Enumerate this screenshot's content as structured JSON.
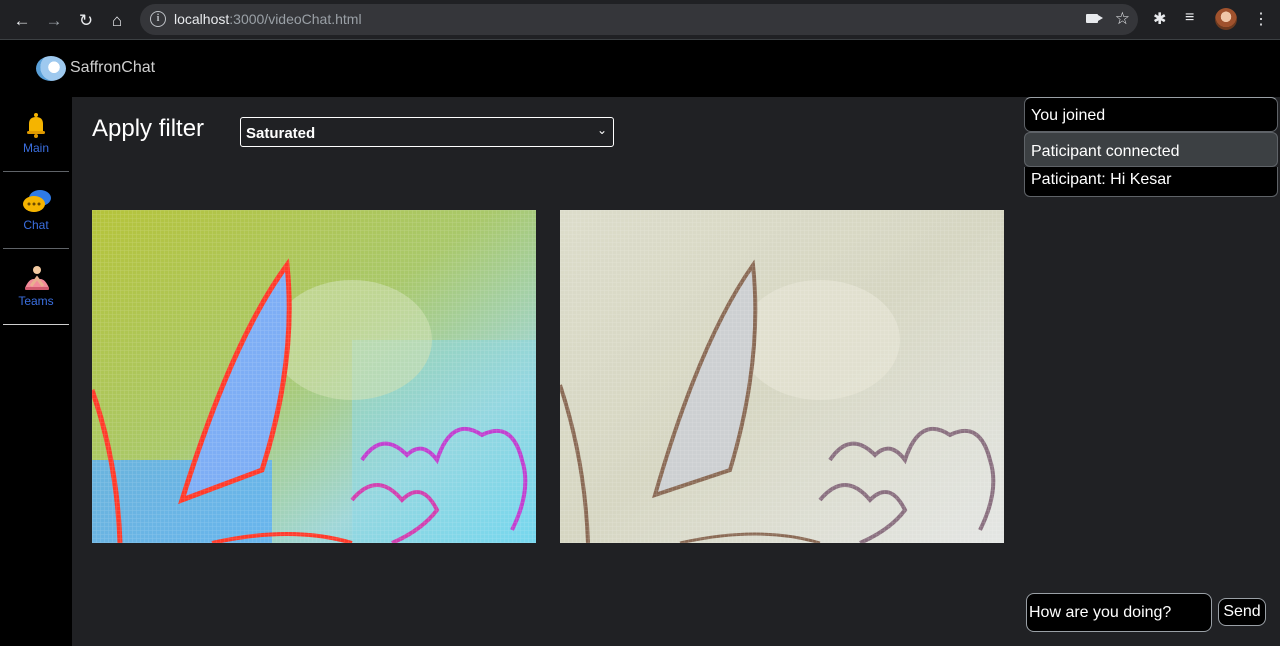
{
  "browser": {
    "url_host": "localhost",
    "url_rest": ":3000/videoChat.html"
  },
  "app": {
    "brand": "SaffronChat"
  },
  "sidebar": {
    "items": [
      {
        "label": "Main",
        "icon": "bell-icon"
      },
      {
        "label": "Chat",
        "icon": "chat-bubbles-icon"
      },
      {
        "label": "Teams",
        "icon": "teams-icon"
      }
    ]
  },
  "main": {
    "filter_label": "Apply filter",
    "filter_value": "Saturated"
  },
  "chat": {
    "messages": [
      {
        "text": "You joined"
      },
      {
        "text": "Paticipant connected"
      },
      {
        "text": "Paticipant: Hi Kesar"
      }
    ],
    "input_value": "How are you doing?",
    "send_label": "Send"
  },
  "colors": {
    "accent_blue": "#3b6fe0",
    "panel_bg": "#202124"
  }
}
